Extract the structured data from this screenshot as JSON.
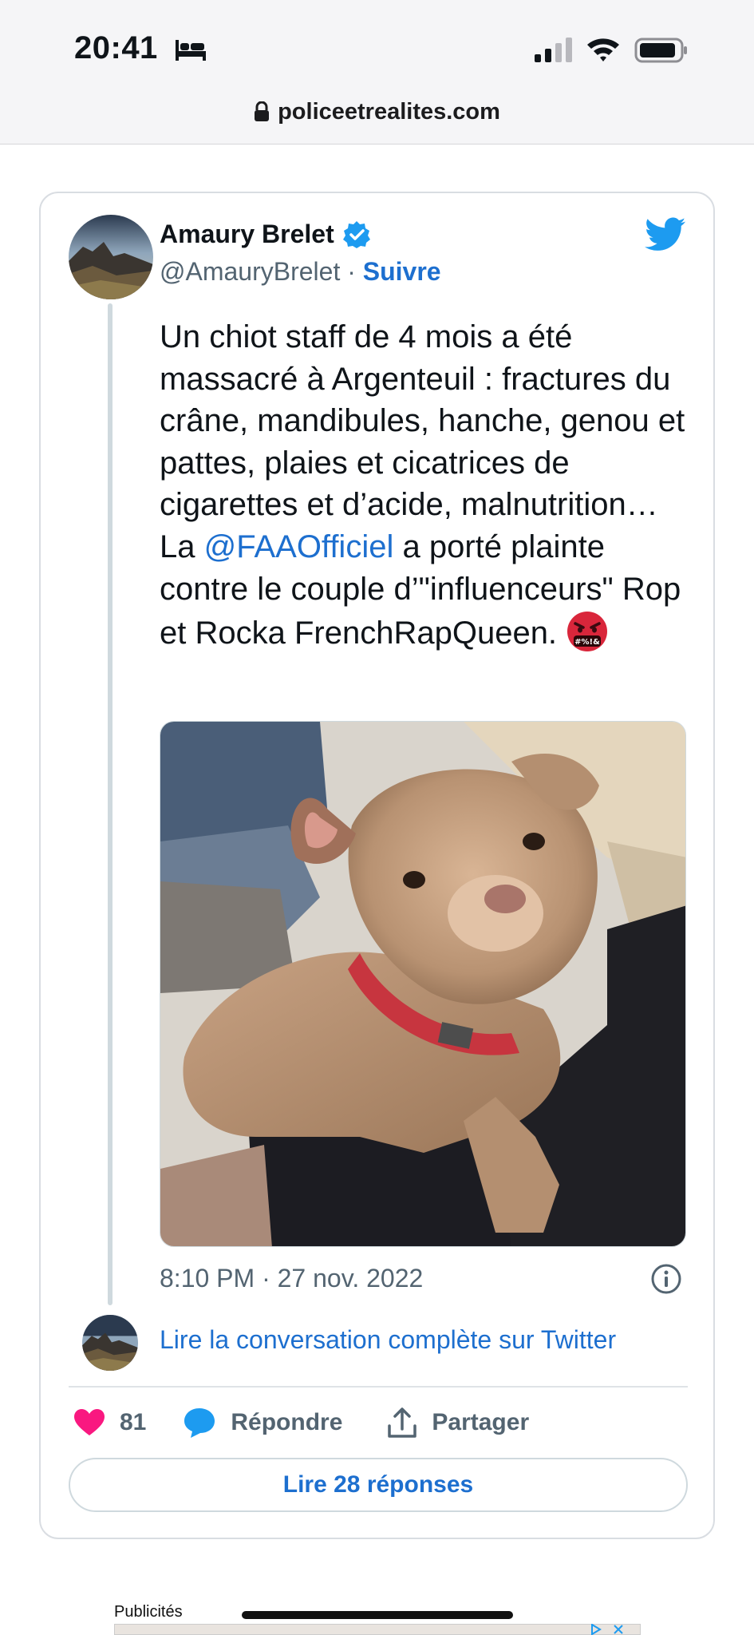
{
  "status_bar": {
    "time": "20:41",
    "icons": [
      "bed-icon",
      "signal-icon",
      "wifi-icon",
      "battery-icon"
    ]
  },
  "browser": {
    "url": "policeetrealites.com",
    "icons": [
      "lock-icon"
    ]
  },
  "tweet": {
    "author_name": "Amaury Brelet",
    "handle": "@AmauryBrelet",
    "separator": "·",
    "follow_label": "Suivre",
    "text_part1": "Un chiot staff de 4 mois a été massacré à Argenteuil : fractures du crâne, mandibules, hanche, genou et pattes, plaies et cicatrices de cigarettes et d’acide, malnutrition… La",
    "mention": "@FAAOfficiel",
    "text_part2": "a porté plainte contre le couple d’\"influenceurs\" Rop et Rocka FrenchRapQueen.",
    "emoji": "angry-cursing-face-icon",
    "photo": "puppy-photo",
    "timestamp": "8:10 PM · 27 nov. 2022",
    "full_conversation_label": "Lire la conversation complète sur Twitter",
    "likes_count": "81",
    "reply_label": "Répondre",
    "share_label": "Partager",
    "read_replies_label": "Lire 28 réponses"
  },
  "ads": {
    "label": "Publicités"
  },
  "colors": {
    "link_blue": "#1d6fcf",
    "twitter_blue": "#1d9bf0",
    "heart_pink": "#f91880",
    "muted_text": "#536471"
  }
}
